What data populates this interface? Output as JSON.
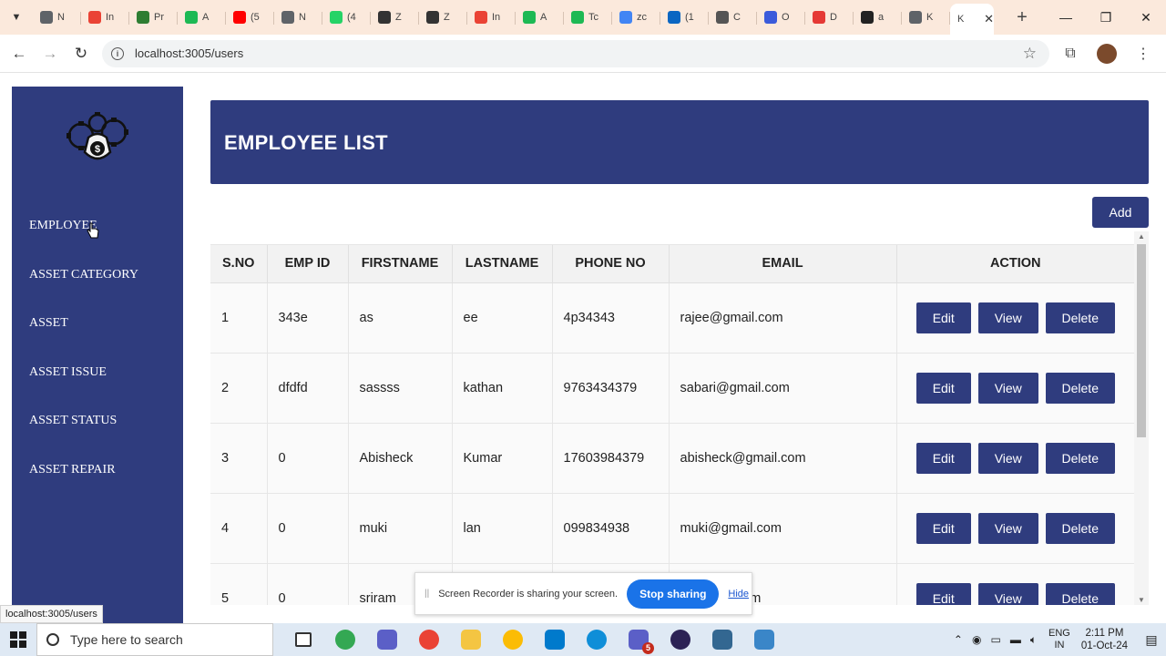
{
  "browser": {
    "tabs": [
      {
        "title": "N",
        "color": "#5f6368"
      },
      {
        "title": "In",
        "color": "#ea4335"
      },
      {
        "title": "Pr",
        "color": "#2e7d32"
      },
      {
        "title": "A",
        "color": "#1db954"
      },
      {
        "title": "(5",
        "color": "#ff0000"
      },
      {
        "title": "N",
        "color": "#5f6368"
      },
      {
        "title": "(4",
        "color": "#25d366"
      },
      {
        "title": "Z",
        "color": "#333333"
      },
      {
        "title": "Z",
        "color": "#333333"
      },
      {
        "title": "In",
        "color": "#ea4335"
      },
      {
        "title": "A",
        "color": "#1db954"
      },
      {
        "title": "Tc",
        "color": "#1db954"
      },
      {
        "title": "zc",
        "color": "#4285f4"
      },
      {
        "title": "(1",
        "color": "#0a66c2"
      },
      {
        "title": "C",
        "color": "#555555"
      },
      {
        "title": "O",
        "color": "#3b5bdb"
      },
      {
        "title": "D",
        "color": "#e53935"
      },
      {
        "title": "a",
        "color": "#222222"
      },
      {
        "title": "K",
        "color": "#5f6368"
      }
    ],
    "active_tab": {
      "title": "K",
      "close": "✕"
    },
    "new_tab": "+",
    "url": "localhost:3005/users",
    "status_url": "localhost:3005/users"
  },
  "sidebar": {
    "items": [
      {
        "label": "EMPLOYEE"
      },
      {
        "label": "ASSET CATEGORY"
      },
      {
        "label": "ASSET"
      },
      {
        "label": "ASSET ISSUE"
      },
      {
        "label": "ASSET STATUS"
      },
      {
        "label": "ASSET REPAIR"
      }
    ]
  },
  "main": {
    "title": "EMPLOYEE LIST",
    "add_label": "Add",
    "columns": [
      "S.NO",
      "EMP ID",
      "FIRSTNAME",
      "LASTNAME",
      "PHONE NO",
      "EMAIL",
      "ACTION"
    ],
    "rows": [
      {
        "sno": "1",
        "emp_id": "343e",
        "first": "as",
        "last": "ee",
        "phone": "4p34343",
        "email": "rajee@gmail.com"
      },
      {
        "sno": "2",
        "emp_id": "dfdfd",
        "first": "sassss",
        "last": "kathan",
        "phone": "9763434379",
        "email": "sabari@gmail.com"
      },
      {
        "sno": "3",
        "emp_id": "0",
        "first": "Abisheck",
        "last": "Kumar",
        "phone": "17603984379",
        "email": "abisheck@gmail.com"
      },
      {
        "sno": "4",
        "emp_id": "0",
        "first": "muki",
        "last": "lan",
        "phone": "099834938",
        "email": "muki@gmail.com"
      },
      {
        "sno": "5",
        "emp_id": "0",
        "first": "sriram",
        "last": "",
        "phone": "",
        "email": "3@gmail.com"
      }
    ],
    "action_labels": {
      "edit": "Edit",
      "view": "View",
      "delete": "Delete"
    }
  },
  "screen_share": {
    "message": "Screen Recorder is sharing your screen.",
    "stop_label": "Stop sharing",
    "hide_label": "Hide"
  },
  "taskbar": {
    "search_placeholder": "Type here to search",
    "lang_line1": "ENG",
    "lang_line2": "IN",
    "time": "2:11 PM",
    "date": "01-Oct-24",
    "teams_badge": "5"
  },
  "colors": {
    "primary": "#2f3c7e",
    "tab_strip": "#fbe9dc",
    "taskbar": "#dfe9f4",
    "stop_button": "#1a73e8"
  }
}
